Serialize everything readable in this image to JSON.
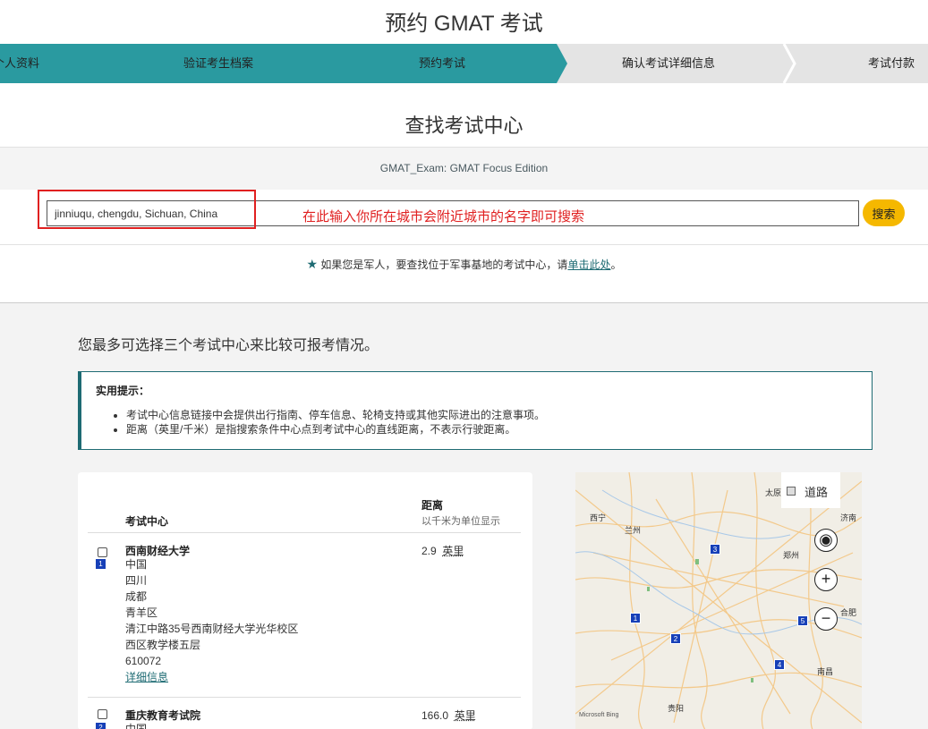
{
  "page": {
    "title": "预约 GMAT 考试"
  },
  "steps": [
    {
      "label": "个人资料"
    },
    {
      "label": "验证考生档案"
    },
    {
      "label": "预约考试"
    },
    {
      "label": "确认考试详细信息"
    },
    {
      "label": "考试付款"
    }
  ],
  "colors": {
    "active_step": "#2a9aa0",
    "inactive_step": "#e4e4e4",
    "accent": "#1e6b73",
    "search_button": "#f5b800",
    "annotation": "#e02020",
    "map_pin": "#1740b8"
  },
  "search": {
    "section_title": "查找考试中心",
    "exam_name": "GMAT_Exam: GMAT Focus Edition",
    "input_value": "jinniuqu, chengdu, Sichuan, China",
    "annotation": "在此输入你所在城市会附近城市的名字即可搜索",
    "button_label": "搜索"
  },
  "military": {
    "text": "如果您是军人，要查找位于军事基地的考试中心，请",
    "link": "单击此处",
    "suffix": "。"
  },
  "compare_text": "您最多可选择三个考试中心来比较可报考情况。",
  "tips": {
    "title": "实用提示：",
    "items": [
      "考试中心信息链接中会提供出行指南、停车信息、轮椅支持或其他实际进出的注意事项。",
      "距离（英里/千米）是指搜索条件中心点到考试中心的直线距离，不表示行驶距离。"
    ]
  },
  "results": {
    "col_center": "考试中心",
    "col_distance": "距离",
    "col_distance_sub": "以千米为单位显示",
    "rows": [
      {
        "pin": "1",
        "name": "西南财经大学",
        "address": [
          "中国",
          "四川",
          "成都",
          "青羊区",
          "清江中路35号西南财经大学光华校区",
          "西区教学楼五层",
          "610072"
        ],
        "details": "详细信息",
        "distance": "2.9",
        "unit": "英里"
      },
      {
        "pin": "2",
        "name": "重庆教育考试院",
        "address": [
          "中国"
        ],
        "details": "",
        "distance": "166.0",
        "unit": "英里"
      }
    ]
  },
  "map": {
    "road_label": "道路",
    "zoom_in": "+",
    "zoom_out": "−",
    "attribution": "Microsoft Bing",
    "cities": [
      "西宁",
      "兰州",
      "太原",
      "济南",
      "郑州",
      "合肥",
      "南昌",
      "贵阳"
    ],
    "pins": [
      "1",
      "2",
      "3",
      "4",
      "5"
    ]
  }
}
